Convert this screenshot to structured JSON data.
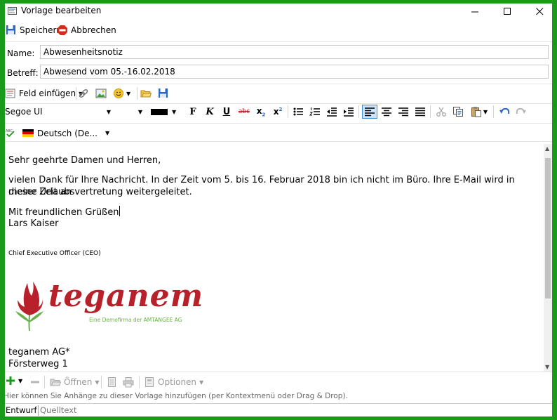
{
  "window": {
    "title": "Vorlage bearbeiten"
  },
  "actions": {
    "save_label": "Speichern",
    "cancel_label": "Abbrechen"
  },
  "fields": {
    "name_label": "Name:",
    "name_value": "Abwesenheitsnotiz",
    "subject_label": "Betreff:",
    "subject_value": "Abwesend vom 05.-16.02.2018"
  },
  "toolbar": {
    "insert_field_label": "Feld einfügen",
    "font_name": "Segoe UI",
    "font_size": "",
    "bold": "F",
    "italic": "K",
    "underline": "U",
    "strike": "abc",
    "subscript": "x",
    "subscript_mark": "2",
    "superscript": "x",
    "superscript_mark": "2",
    "text_color": "#000000"
  },
  "spellcheck": {
    "language": "Deutsch (De..."
  },
  "editor": {
    "greeting": "Sehr geehrte Damen und Herren,",
    "body_line1": "vielen Dank für Ihre Nachricht. In der Zeit vom 5. bis 16. Februar 2018 bin ich nicht im Büro. Ihre E-Mail wird in dieser Zeit an",
    "body_line2": "meine Urlaubsvertretung weitergeleitet.",
    "closing": "Mit freundlichen Grüßen",
    "sender": "Lars Kaiser",
    "job_title": "Chief Executive Officer (CEO)",
    "logo_text": "teganem",
    "logo_tagline": "Eine Demofirma der AMTANGEE AG",
    "company": "teganem AG*",
    "street": "Försterweg 1"
  },
  "attachments": {
    "open_label": "Öffnen",
    "options_label": "Optionen",
    "hint": "Hier können Sie Anhänge zu dieser Vorlage hinzufügen (per Kontextmenü oder Drag & Drop)."
  },
  "tabs": {
    "design": "Entwurf",
    "source": "Quelltext"
  },
  "colors": {
    "frame": "#1a9a1a",
    "logo_red": "#b8202a",
    "logo_green": "#6ab04c",
    "accent_blue": "#2a66c4"
  }
}
